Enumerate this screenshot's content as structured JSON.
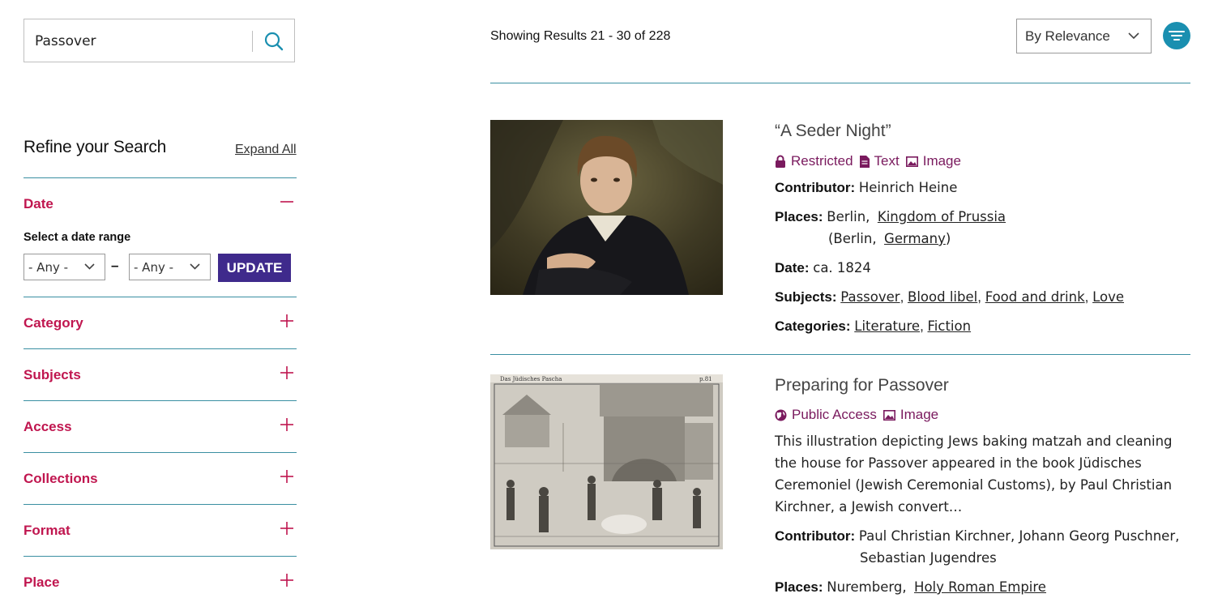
{
  "search": {
    "value": "Passover"
  },
  "refine": {
    "title": "Refine your Search",
    "expand_all": "Expand All",
    "date": {
      "label": "Date",
      "range_label": "Select a date range",
      "from": "- Any -",
      "dash": "–",
      "to": "- Any -",
      "update": "UPDATE"
    },
    "facets": [
      "Category",
      "Subjects",
      "Access",
      "Collections",
      "Format",
      "Place"
    ]
  },
  "results_header": {
    "count_text": "Showing Results 21 - 30 of 228",
    "sort": "By Relevance"
  },
  "results": [
    {
      "title": "“A Seder Night”",
      "badges": [
        "Restricted",
        "Text",
        "Image"
      ],
      "contributor_label": "Contributor:",
      "contributor": "Heinrich Heine",
      "places_label": "Places:",
      "place_1_city": "Berlin,",
      "place_1_link": "Kingdom of Prussia",
      "place_2_open": "(Berlin,",
      "place_2_link": "Germany",
      "place_2_close": ")",
      "date_label": "Date:",
      "date": "ca. 1824",
      "subjects_label": "Subjects:",
      "subjects": [
        "Passover",
        "Blood libel",
        "Food and drink",
        "Love"
      ],
      "categories_label": "Categories:",
      "categories": [
        "Literature",
        "Fiction"
      ]
    },
    {
      "title": "Preparing for Passover",
      "badges": [
        "Public Access",
        "Image"
      ],
      "desc_lines": [
        "This illustration depicting Jews baking matzah and cleaning",
        "the house for Passover appeared in the book Jüdisches",
        "Ceremoniel (Jewish Ceremonial Customs), by Paul Christian",
        "Kirchner, a Jewish convert…"
      ],
      "contributor_label": "Contributor:",
      "contributor_line_1": "Paul Christian Kirchner, Johann Georg Puschner,",
      "contributor_line_2": "Sebastian Jugendres",
      "places_label": "Places:",
      "place_city": "Nuremberg,",
      "place_link": "Holy Roman Empire",
      "header_text_left": "Das Jüdisches Pascha",
      "header_text_right": "p.81"
    }
  ],
  "colors": {
    "accent_red": "#c0164f",
    "teal": "#3a8fa2",
    "purple_button": "#3f2a8c",
    "badge_purple": "#7a1a5e",
    "filter_blue": "#1a8fb0"
  }
}
